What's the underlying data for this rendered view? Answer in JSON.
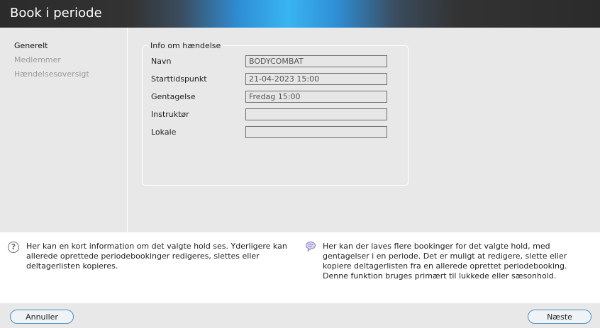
{
  "window": {
    "title": "Book i periode"
  },
  "sidebar": {
    "items": [
      {
        "label": "Generelt",
        "state": "active"
      },
      {
        "label": "Medlemmer",
        "state": "inactive"
      },
      {
        "label": "Hændelsesoversigt",
        "state": "inactive"
      }
    ]
  },
  "form": {
    "group_title": "Info om hændelse",
    "fields": [
      {
        "label": "Navn",
        "value": "BODYCOMBAT"
      },
      {
        "label": "Starttidspunkt",
        "value": "21-04-2023 15:00"
      },
      {
        "label": "Gentagelse",
        "value": "Fredag 15:00"
      },
      {
        "label": "Instruktør",
        "value": ""
      },
      {
        "label": "Lokale",
        "value": ""
      }
    ]
  },
  "info": {
    "left_text": "Her kan en kort information om det valgte hold ses. Yderligere kan allerede oprettede periodebookinger redigeres, slettes eller deltagerlisten kopieres.",
    "right_text": "Her kan der laves flere bookinger for det valgte hold, med gentagelser i en periode. Det er muligt at redigere, slette eller kopiere deltagerlisten fra en allerede oprettet periodebooking. Denne funktion bruges primært til lukkede eller sæsonhold.",
    "left_icon": "help-circle-icon",
    "right_icon": "chat-bubble-icon"
  },
  "footer": {
    "cancel_label": "Annuller",
    "next_label": "Næste"
  },
  "colors": {
    "title_accent": "#39b4f2",
    "button_border": "#4a8fc6"
  }
}
